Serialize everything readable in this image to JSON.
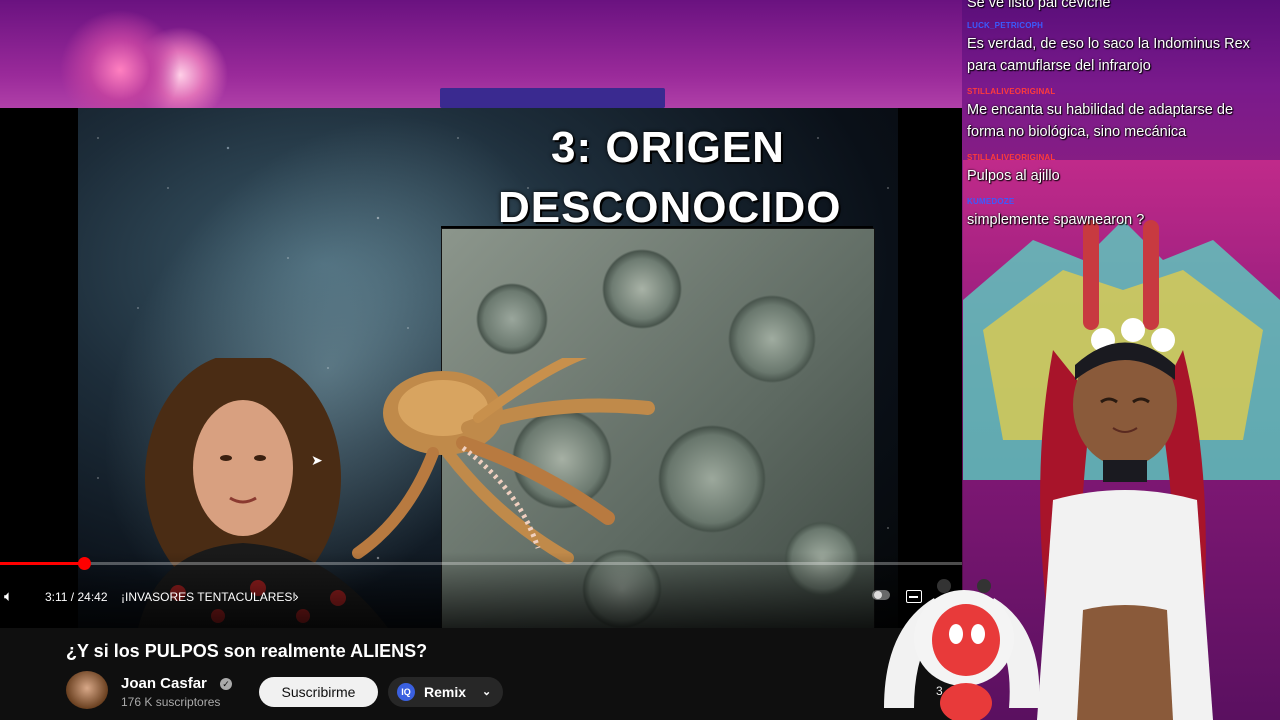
{
  "player": {
    "slide_title_line1": "3: ORIGEN",
    "slide_title_line2": "DESCONOCIDO",
    "time_display": "3:11 / 24:42",
    "chapter_label": "¡INVASORES TENTACULARES!",
    "progress_fraction": 0.0873
  },
  "video": {
    "title": "¿Y si los PULPOS son realmente ALIENS?",
    "channel_name": "Joan Casfar",
    "subscribers": "176 K suscriptores",
    "subscribe_label": "Suscribirme",
    "remix_label": "Remix"
  },
  "chat": {
    "messages": [
      {
        "user": "",
        "text": "Se ve listo pal ceviche",
        "user_color": "#ff3b3b"
      },
      {
        "user": "LUCK_PETRICOPH",
        "text": "Es verdad, de eso lo saco la Indominus Rex para camuflarse del infrarojo",
        "user_color": "#3b5bff"
      },
      {
        "user": "STILLALIVEORIGINAL",
        "text": "Me encanta su habilidad de adaptarse de forma no biológica, sino mecánica",
        "user_color": "#ff3b3b"
      },
      {
        "user": "STILLALIVEORIGINAL",
        "text": "Pulpos al ajillo",
        "user_color": "#ff3b3b"
      },
      {
        "user": "KUMEDOZE",
        "text": "simplemente spawnearon ?",
        "user_color": "#3b5bff"
      }
    ]
  },
  "overlay": {
    "corner_number": "3"
  },
  "colors": {
    "accent_red": "#ff0000",
    "page_bg": "#0f0f0f",
    "stream_bg": "#8e1f7e"
  }
}
